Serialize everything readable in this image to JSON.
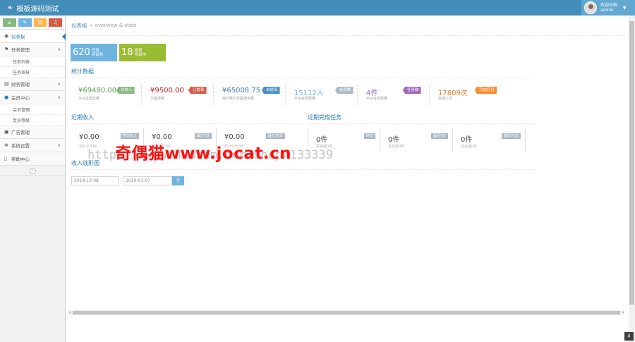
{
  "app": {
    "title": "模板源码测试"
  },
  "user": {
    "greeting": "欢迎光临,",
    "name": "admin"
  },
  "shortcuts": [
    {
      "icon": "home-icon",
      "glyph": "⌂",
      "color": "#87b87f"
    },
    {
      "icon": "pencil-icon",
      "glyph": "✎",
      "color": "#6fb3e0"
    },
    {
      "icon": "users-icon",
      "glyph": "☺",
      "color": "#ffb752"
    },
    {
      "icon": "bell-icon",
      "glyph": "♫",
      "color": "#d15b47"
    }
  ],
  "sidebar": {
    "dashboard": "仪表板",
    "tasks": {
      "label": "任务管理",
      "subs": [
        "任务列表",
        "任务审核"
      ]
    },
    "finance": "财务管理",
    "members": {
      "label": "会员中心",
      "subs": [
        "会员管理",
        "会员等级"
      ]
    },
    "ads": "广告管理",
    "settings": "系统设置",
    "help": "帮助中心",
    "collapse": "«"
  },
  "breadcrumb": {
    "current": "仪表板",
    "separator": "»",
    "sub": "overview & stats"
  },
  "infoboxes": [
    {
      "num": "620",
      "line1": "任务",
      "line2": "待审核",
      "color": "#6fb3e0"
    },
    {
      "num": "18",
      "line1": "提现",
      "line2": "待审核",
      "color": "#9abc32"
    }
  ],
  "sections": {
    "stats": "统计数据",
    "income": "近期收入",
    "tasks_done": "近期完成任务",
    "chart": "收入线形图"
  },
  "stats": [
    {
      "value": "¥69480.00",
      "sub": "平台总营业额",
      "tag": "总收入",
      "value_color": "#629b58",
      "tag_color": "#87b87f"
    },
    {
      "value": "¥9500.00",
      "sub": "已提现金",
      "tag": "已提现",
      "value_color": "#c5221e",
      "tag_color": "#d15b47"
    },
    {
      "value": "¥65008.75",
      "sub": "用户账户可提现余额",
      "tag": "未提现",
      "value_color": "#3c7fb1",
      "tag_color": "#478fca"
    },
    {
      "value": "15112人",
      "sub": "平台会员数量",
      "tag": "会员数",
      "value_color": "#6fb3e0",
      "tag_color": "#abbac3"
    },
    {
      "value": "4件",
      "sub": "平台任务数量",
      "tag": "任务数",
      "value_color": "#a069c3",
      "tag_color": "#a069c3"
    },
    {
      "value": "17809次",
      "sub": "完成人次",
      "tag": "完成任务",
      "value_color": "#e8772a",
      "tag_color": "#ff892a"
    }
  ],
  "income": [
    {
      "value": "¥0.00",
      "sub": "共计￥0.00",
      "tag": "昨日收入"
    },
    {
      "value": "¥0.00",
      "sub": "共计￥0.00",
      "tag": "最近7日"
    },
    {
      "value": "¥0.00",
      "sub": "共计￥0.00",
      "tag": "最近30日"
    }
  ],
  "tasks_done": [
    {
      "value": "0件",
      "sub": "共完成0件",
      "tag": "昨日"
    },
    {
      "value": "0件",
      "sub": "共完成0件",
      "tag": "最近7日"
    },
    {
      "value": "0件",
      "sub": "共完成0件",
      "tag": "最近30日"
    }
  ],
  "date_range": {
    "start": "2018-12-08",
    "dash": "-",
    "end": "2019-01-07"
  },
  "watermark": {
    "red": "奇偶猫www.jocat.cn",
    "grey": "https://www.hxuahm.com/shop/133339"
  }
}
